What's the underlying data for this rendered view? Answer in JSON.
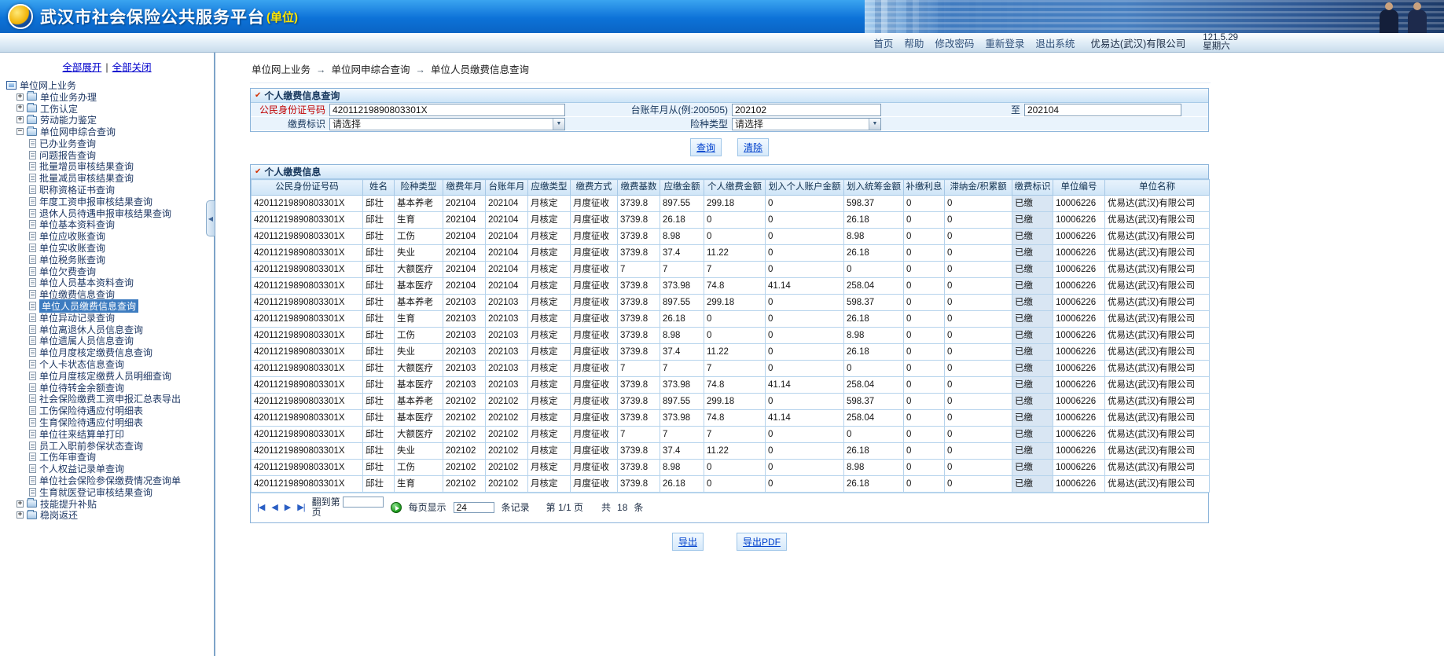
{
  "icons": {
    "section": "✔",
    "dropdown": "▼",
    "pager_first": "|◀",
    "pager_prev": "◀",
    "pager_next": "▶",
    "pager_last": "▶|",
    "sidebar_collapse": "◀",
    "breadcrumb_arrow": "→"
  },
  "colors": {
    "header_blue": "#0d72d8",
    "suffix_yellow": "#ffe400",
    "selected_tree": "#3d7cc0",
    "label_red": "#c00000",
    "link_blue": "#0040cc"
  },
  "header": {
    "title": "武汉市社会保险公共服务平台",
    "title_suffix": "(单位)",
    "company": "优易达(武汉)有限公司",
    "date": "121.5.29",
    "weekday": "星期六",
    "nav": [
      "首页",
      "帮助",
      "修改密码",
      "重新登录",
      "退出系统"
    ]
  },
  "sidebar": {
    "expand_all": "全部展开",
    "collapse_all": "全部关闭",
    "tree": [
      {
        "label": "单位网上业务",
        "kind": "root"
      },
      {
        "label": "单位业务办理",
        "kind": "branch",
        "expander": "+"
      },
      {
        "label": "工伤认定",
        "kind": "branch",
        "expander": "+"
      },
      {
        "label": "劳动能力鉴定",
        "kind": "branch",
        "expander": "+"
      },
      {
        "label": "单位网申综合查询",
        "kind": "branch",
        "expander": "-",
        "open": true
      },
      {
        "label": "已办业务查询",
        "kind": "leaf"
      },
      {
        "label": "问题报告查询",
        "kind": "leaf"
      },
      {
        "label": "批量增员审核结果查询",
        "kind": "leaf"
      },
      {
        "label": "批量减员审核结果查询",
        "kind": "leaf"
      },
      {
        "label": "职称资格证书查询",
        "kind": "leaf"
      },
      {
        "label": "年度工资申报审核结果查询",
        "kind": "leaf"
      },
      {
        "label": "退休人员待遇申报审核结果查询",
        "kind": "leaf"
      },
      {
        "label": "单位基本资料查询",
        "kind": "leaf"
      },
      {
        "label": "单位应收账查询",
        "kind": "leaf"
      },
      {
        "label": "单位实收账查询",
        "kind": "leaf"
      },
      {
        "label": "单位税务账查询",
        "kind": "leaf"
      },
      {
        "label": "单位欠费查询",
        "kind": "leaf"
      },
      {
        "label": "单位人员基本资料查询",
        "kind": "leaf"
      },
      {
        "label": "单位缴费信息查询",
        "kind": "leaf"
      },
      {
        "label": "单位人员缴费信息查询",
        "kind": "leaf",
        "selected": true
      },
      {
        "label": "单位异动记录查询",
        "kind": "leaf"
      },
      {
        "label": "单位离退休人员信息查询",
        "kind": "leaf"
      },
      {
        "label": "单位遗属人员信息查询",
        "kind": "leaf"
      },
      {
        "label": "单位月度核定缴费信息查询",
        "kind": "leaf"
      },
      {
        "label": "个人卡状态信息查询",
        "kind": "leaf"
      },
      {
        "label": "单位月度核定缴费人员明细查询",
        "kind": "leaf"
      },
      {
        "label": "单位待转金余额查询",
        "kind": "leaf"
      },
      {
        "label": "社会保险缴费工资申报汇总表导出",
        "kind": "leaf"
      },
      {
        "label": "工伤保险待遇应付明细表",
        "kind": "leaf"
      },
      {
        "label": "生育保险待遇应付明细表",
        "kind": "leaf"
      },
      {
        "label": "单位往来结算单打印",
        "kind": "leaf"
      },
      {
        "label": "员工入职前参保状态查询",
        "kind": "leaf"
      },
      {
        "label": "工伤年审查询",
        "kind": "leaf"
      },
      {
        "label": "个人权益记录单查询",
        "kind": "leaf"
      },
      {
        "label": "单位社会保险参保缴费情况查询单",
        "kind": "leaf"
      },
      {
        "label": "生育就医登记审核结果查询",
        "kind": "leaf"
      },
      {
        "label": "技能提升补贴",
        "kind": "branch",
        "expander": "+"
      },
      {
        "label": "稳岗返还",
        "kind": "branch",
        "expander": "+"
      }
    ]
  },
  "breadcrumb": [
    "单位网上业务",
    "单位网申综合查询",
    "单位人员缴费信息查询"
  ],
  "query": {
    "section_title": "个人缴费信息查询",
    "id_label": "公民身份证号码",
    "id_value": "42011219890803301X",
    "month_from_label": "台账年月从(例:200505)",
    "month_from_value": "202102",
    "to_label": "至",
    "month_to_value": "202104",
    "pay_flag_label": "缴费标识",
    "pay_flag_value": "请选择",
    "ins_type_label": "险种类型",
    "ins_type_value": "请选择",
    "search_label": "查询",
    "clear_label": "清除"
  },
  "results": {
    "section_title": "个人缴费信息",
    "columns": [
      "公民身份证号码",
      "姓名",
      "险种类型",
      "缴费年月",
      "台账年月",
      "应缴类型",
      "缴费方式",
      "缴费基数",
      "应缴金额",
      "个人缴费金额",
      "划入个人账户金额",
      "划入统筹金额",
      "补缴利息",
      "滞纳金/积累额",
      "缴费标识",
      "单位编号",
      "单位名称"
    ],
    "rows": [
      [
        "42011219890803301X",
        "邱壮",
        "基本养老",
        "202104",
        "202104",
        "月核定",
        "月度征收",
        "3739.8",
        "897.55",
        "299.18",
        "0",
        "598.37",
        "0",
        "0",
        "已缴",
        "10006226",
        "优易达(武汉)有限公司"
      ],
      [
        "42011219890803301X",
        "邱壮",
        "生育",
        "202104",
        "202104",
        "月核定",
        "月度征收",
        "3739.8",
        "26.18",
        "0",
        "0",
        "26.18",
        "0",
        "0",
        "已缴",
        "10006226",
        "优易达(武汉)有限公司"
      ],
      [
        "42011219890803301X",
        "邱壮",
        "工伤",
        "202104",
        "202104",
        "月核定",
        "月度征收",
        "3739.8",
        "8.98",
        "0",
        "0",
        "8.98",
        "0",
        "0",
        "已缴",
        "10006226",
        "优易达(武汉)有限公司"
      ],
      [
        "42011219890803301X",
        "邱壮",
        "失业",
        "202104",
        "202104",
        "月核定",
        "月度征收",
        "3739.8",
        "37.4",
        "11.22",
        "0",
        "26.18",
        "0",
        "0",
        "已缴",
        "10006226",
        "优易达(武汉)有限公司"
      ],
      [
        "42011219890803301X",
        "邱壮",
        "大额医疗",
        "202104",
        "202104",
        "月核定",
        "月度征收",
        "7",
        "7",
        "7",
        "0",
        "0",
        "0",
        "0",
        "已缴",
        "10006226",
        "优易达(武汉)有限公司"
      ],
      [
        "42011219890803301X",
        "邱壮",
        "基本医疗",
        "202104",
        "202104",
        "月核定",
        "月度征收",
        "3739.8",
        "373.98",
        "74.8",
        "41.14",
        "258.04",
        "0",
        "0",
        "已缴",
        "10006226",
        "优易达(武汉)有限公司"
      ],
      [
        "42011219890803301X",
        "邱壮",
        "基本养老",
        "202103",
        "202103",
        "月核定",
        "月度征收",
        "3739.8",
        "897.55",
        "299.18",
        "0",
        "598.37",
        "0",
        "0",
        "已缴",
        "10006226",
        "优易达(武汉)有限公司"
      ],
      [
        "42011219890803301X",
        "邱壮",
        "生育",
        "202103",
        "202103",
        "月核定",
        "月度征收",
        "3739.8",
        "26.18",
        "0",
        "0",
        "26.18",
        "0",
        "0",
        "已缴",
        "10006226",
        "优易达(武汉)有限公司"
      ],
      [
        "42011219890803301X",
        "邱壮",
        "工伤",
        "202103",
        "202103",
        "月核定",
        "月度征收",
        "3739.8",
        "8.98",
        "0",
        "0",
        "8.98",
        "0",
        "0",
        "已缴",
        "10006226",
        "优易达(武汉)有限公司"
      ],
      [
        "42011219890803301X",
        "邱壮",
        "失业",
        "202103",
        "202103",
        "月核定",
        "月度征收",
        "3739.8",
        "37.4",
        "11.22",
        "0",
        "26.18",
        "0",
        "0",
        "已缴",
        "10006226",
        "优易达(武汉)有限公司"
      ],
      [
        "42011219890803301X",
        "邱壮",
        "大额医疗",
        "202103",
        "202103",
        "月核定",
        "月度征收",
        "7",
        "7",
        "7",
        "0",
        "0",
        "0",
        "0",
        "已缴",
        "10006226",
        "优易达(武汉)有限公司"
      ],
      [
        "42011219890803301X",
        "邱壮",
        "基本医疗",
        "202103",
        "202103",
        "月核定",
        "月度征收",
        "3739.8",
        "373.98",
        "74.8",
        "41.14",
        "258.04",
        "0",
        "0",
        "已缴",
        "10006226",
        "优易达(武汉)有限公司"
      ],
      [
        "42011219890803301X",
        "邱壮",
        "基本养老",
        "202102",
        "202102",
        "月核定",
        "月度征收",
        "3739.8",
        "897.55",
        "299.18",
        "0",
        "598.37",
        "0",
        "0",
        "已缴",
        "10006226",
        "优易达(武汉)有限公司"
      ],
      [
        "42011219890803301X",
        "邱壮",
        "基本医疗",
        "202102",
        "202102",
        "月核定",
        "月度征收",
        "3739.8",
        "373.98",
        "74.8",
        "41.14",
        "258.04",
        "0",
        "0",
        "已缴",
        "10006226",
        "优易达(武汉)有限公司"
      ],
      [
        "42011219890803301X",
        "邱壮",
        "大额医疗",
        "202102",
        "202102",
        "月核定",
        "月度征收",
        "7",
        "7",
        "7",
        "0",
        "0",
        "0",
        "0",
        "已缴",
        "10006226",
        "优易达(武汉)有限公司"
      ],
      [
        "42011219890803301X",
        "邱壮",
        "失业",
        "202102",
        "202102",
        "月核定",
        "月度征收",
        "3739.8",
        "37.4",
        "11.22",
        "0",
        "26.18",
        "0",
        "0",
        "已缴",
        "10006226",
        "优易达(武汉)有限公司"
      ],
      [
        "42011219890803301X",
        "邱壮",
        "工伤",
        "202102",
        "202102",
        "月核定",
        "月度征收",
        "3739.8",
        "8.98",
        "0",
        "0",
        "8.98",
        "0",
        "0",
        "已缴",
        "10006226",
        "优易达(武汉)有限公司"
      ],
      [
        "42011219890803301X",
        "邱壮",
        "生育",
        "202102",
        "202102",
        "月核定",
        "月度征收",
        "3739.8",
        "26.18",
        "0",
        "0",
        "26.18",
        "0",
        "0",
        "已缴",
        "10006226",
        "优易达(武汉)有限公司"
      ]
    ],
    "pager": {
      "goto_label": "翻到第",
      "goto_suffix": "页",
      "per_page_label": "每页显示",
      "per_page_value": "24",
      "per_page_suffix": "条记录",
      "page_info": "第 1/1 页",
      "total_label": "共",
      "total_value": "18",
      "total_suffix": "条"
    },
    "export_label": "导出",
    "export_pdf_label": "导出PDF"
  }
}
